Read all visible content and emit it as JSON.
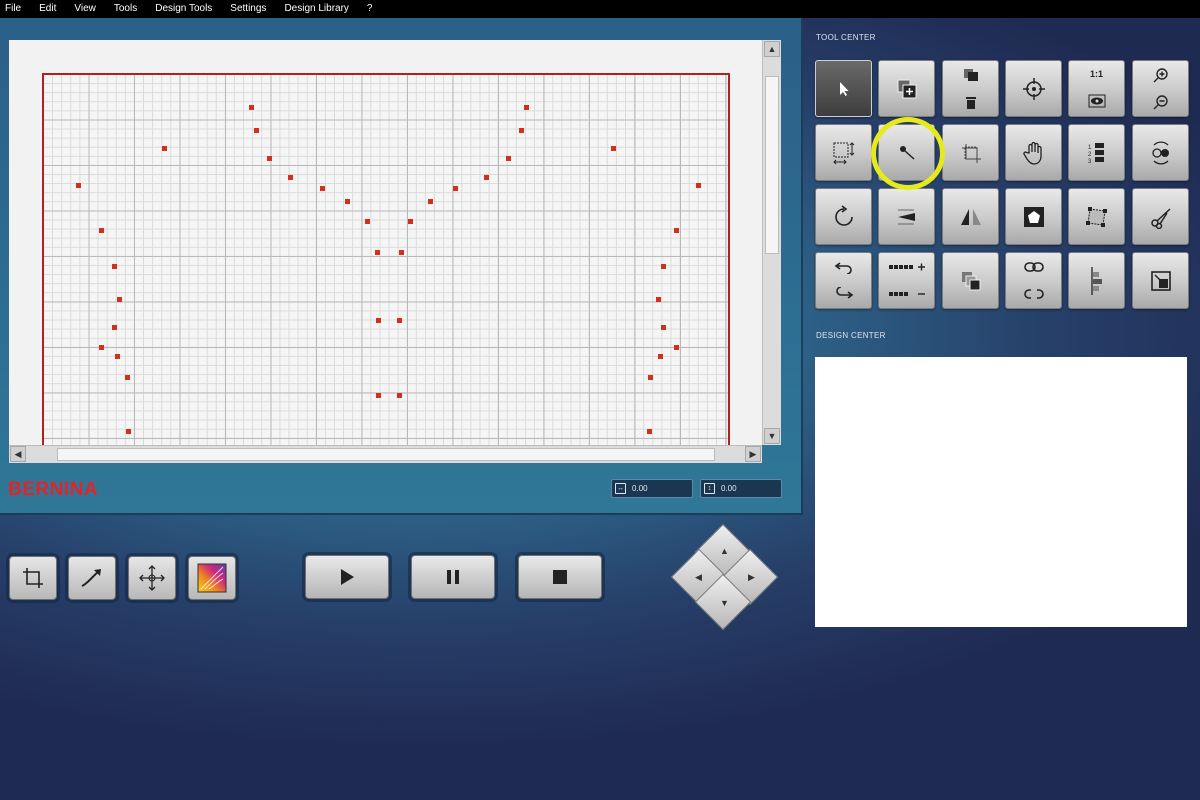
{
  "menu": [
    "File",
    "Edit",
    "View",
    "Tools",
    "Design Tools",
    "Settings",
    "Design Library",
    "?"
  ],
  "brand": "BERNINA",
  "coords": {
    "width_value": "0.00",
    "height_value": "0.00"
  },
  "tool_center": {
    "title": "TOOL CENTER",
    "zoom_label": "1:1",
    "buttons": [
      "select-arrow",
      "duplicate-add",
      "copy-delete",
      "center-target",
      "one-to-one-view",
      "zoom-in-out",
      "resize",
      "needle-pin",
      "crop",
      "pan-hand",
      "numbered-sequence",
      "rotate-color",
      "rotate",
      "skew",
      "mirror",
      "shape-pentagon",
      "transform-frame",
      "scissors",
      "undo-redo",
      "stitch-add-remove",
      "layer-order",
      "link-unlink",
      "align",
      "resize-corner"
    ]
  },
  "design_center": {
    "title": "DESIGN CENTER"
  },
  "bottom_tools": [
    "crop-tool",
    "curve-tool",
    "move-tool",
    "color-tool"
  ],
  "playback": [
    "play",
    "pause",
    "stop"
  ],
  "dpad": [
    "up",
    "left",
    "right",
    "down"
  ],
  "colors": {
    "stitch": "#d22f1e",
    "highlight": "#e6ea1c",
    "brand": "#e0252a"
  }
}
